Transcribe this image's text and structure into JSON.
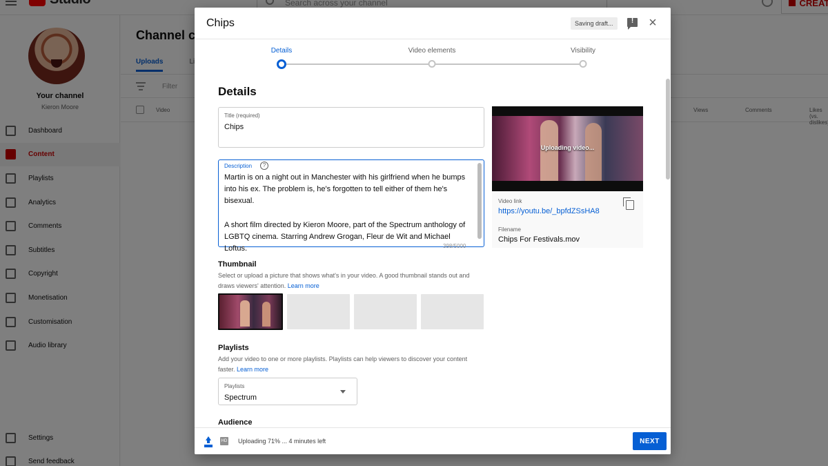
{
  "app": {
    "logo_text": "Studio",
    "search_placeholder": "Search across your channel",
    "create_label": "CREATE"
  },
  "sidebar": {
    "channel_label": "Your channel",
    "channel_owner": "Kieron Moore",
    "items": [
      {
        "label": "Dashboard",
        "icon": "dashboard-icon"
      },
      {
        "label": "Content",
        "icon": "content-icon",
        "active": true
      },
      {
        "label": "Playlists",
        "icon": "playlists-icon"
      },
      {
        "label": "Analytics",
        "icon": "analytics-icon"
      },
      {
        "label": "Comments",
        "icon": "comments-icon"
      },
      {
        "label": "Subtitles",
        "icon": "subtitles-icon"
      },
      {
        "label": "Copyright",
        "icon": "copyright-icon"
      },
      {
        "label": "Monetisation",
        "icon": "monetisation-icon"
      },
      {
        "label": "Customisation",
        "icon": "customisation-icon"
      },
      {
        "label": "Audio library",
        "icon": "audio-library-icon"
      }
    ],
    "bottom_items": [
      {
        "label": "Settings",
        "icon": "settings-icon"
      },
      {
        "label": "Send feedback",
        "icon": "feedback-icon"
      }
    ]
  },
  "main": {
    "title": "Channel content",
    "tabs": [
      {
        "label": "Uploads",
        "active": true
      },
      {
        "label": "Live"
      }
    ],
    "filter_placeholder": "Filter",
    "columns": [
      "Video",
      "Views",
      "Comments",
      "Likes (vs. dislikes)"
    ]
  },
  "dialog": {
    "title": "Chips",
    "saving_label": "Saving draft...",
    "steps": [
      {
        "label": "Details",
        "active": true
      },
      {
        "label": "Video elements"
      },
      {
        "label": "Visibility"
      }
    ],
    "section_title": "Details",
    "title_field": {
      "label": "Title (required)",
      "value": "Chips"
    },
    "description_field": {
      "label": "Description",
      "value": "Martin is on a night out in Manchester with his girlfriend when he bumps into his ex. The problem is, he's forgotten to tell either of them he's bisexual.\n\nA short film directed by Kieron Moore, part of the Spectrum anthology of LGBTQ cinema. Starring Andrew Grogan, Fleur de Wit and Michael Loftus.",
      "char_count": "398/5000"
    },
    "thumbnail": {
      "title": "Thumbnail",
      "help": "Select or upload a picture that shows what's in your video. A good thumbnail stands out and draws viewers' attention.",
      "learn_more": "Learn more"
    },
    "playlists": {
      "title": "Playlists",
      "help": "Add your video to one or more playlists. Playlists can help viewers to discover your content faster.",
      "learn_more": "Learn more",
      "select_label": "Playlists",
      "select_value": "Spectrum"
    },
    "audience_title": "Audience",
    "preview": {
      "overlay_text": "Uploading video...",
      "link_label": "Video link",
      "link_value": "https://youtu.be/_bpfdZSsHA8",
      "filename_label": "Filename",
      "filename_value": "Chips For Festivals.mov"
    },
    "footer": {
      "status": "Uploading 71% ... 4 minutes left",
      "upload_progress": 0.71,
      "hd_badge": "HD",
      "next_label": "NEXT"
    }
  },
  "colors": {
    "accent": "#065fd4",
    "brand_red": "#ff0000",
    "active_nav": "#cc0000"
  }
}
